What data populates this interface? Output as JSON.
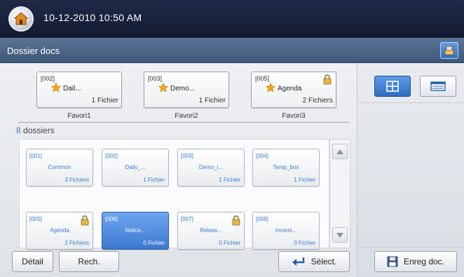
{
  "status_bar": {
    "datetime": "10-12-2010 10:50 AM"
  },
  "header": {
    "title": "Dossier docs"
  },
  "favorites": [
    {
      "code": "[002]",
      "name": "Dail...",
      "count": "1 Fichier",
      "label": "Favori1",
      "locked": false
    },
    {
      "code": "[003]",
      "name": "Demo...",
      "count": "1 Fichier",
      "label": "Favori2",
      "locked": false
    },
    {
      "code": "[005]",
      "name": "Agenda",
      "count": "2 Fichiers",
      "label": "Favori3",
      "locked": true
    }
  ],
  "folder_count": {
    "number": "8",
    "text": " dossiers"
  },
  "folders": [
    {
      "code": "[001]",
      "name": "Common",
      "count": "3 Fichiers",
      "locked": false,
      "selected": false
    },
    {
      "code": "[002]",
      "name": "Daily_...",
      "count": "1 Fichier",
      "locked": false,
      "selected": false
    },
    {
      "code": "[003]",
      "name": "Demo_i...",
      "count": "1 Fichier",
      "locked": false,
      "selected": false
    },
    {
      "code": "[004]",
      "name": "Temp_box",
      "count": "1 Fichier",
      "locked": false,
      "selected": false
    },
    {
      "code": "[005]",
      "name": "Agenda",
      "count": "2 Fichiers",
      "locked": true,
      "selected": false
    },
    {
      "code": "[006]",
      "name": "Notice...",
      "count": "0 Fichier",
      "locked": false,
      "selected": true
    },
    {
      "code": "[007]",
      "name": "Releas...",
      "count": "0 Fichier",
      "locked": true,
      "selected": false
    },
    {
      "code": "[008]",
      "name": "Incomi...",
      "count": "0 Fichier",
      "locked": false,
      "selected": false
    }
  ],
  "buttons": {
    "detail": "Détail",
    "search": "Rech.",
    "select": "Sélect.",
    "save": "Enreg doc."
  },
  "view_mode": {
    "active": "grid"
  },
  "colors": {
    "accent": "#3a7bd5",
    "header": "#1f2a47",
    "title_bar": "#4f6888"
  },
  "icons": {
    "home": "home-icon",
    "tray": "tray-icon",
    "star": "star-icon",
    "lock": "lock-icon",
    "grid": "grid-view-icon",
    "list": "list-view-icon",
    "enter": "enter-arrow-icon",
    "save": "floppy-disk-icon"
  }
}
